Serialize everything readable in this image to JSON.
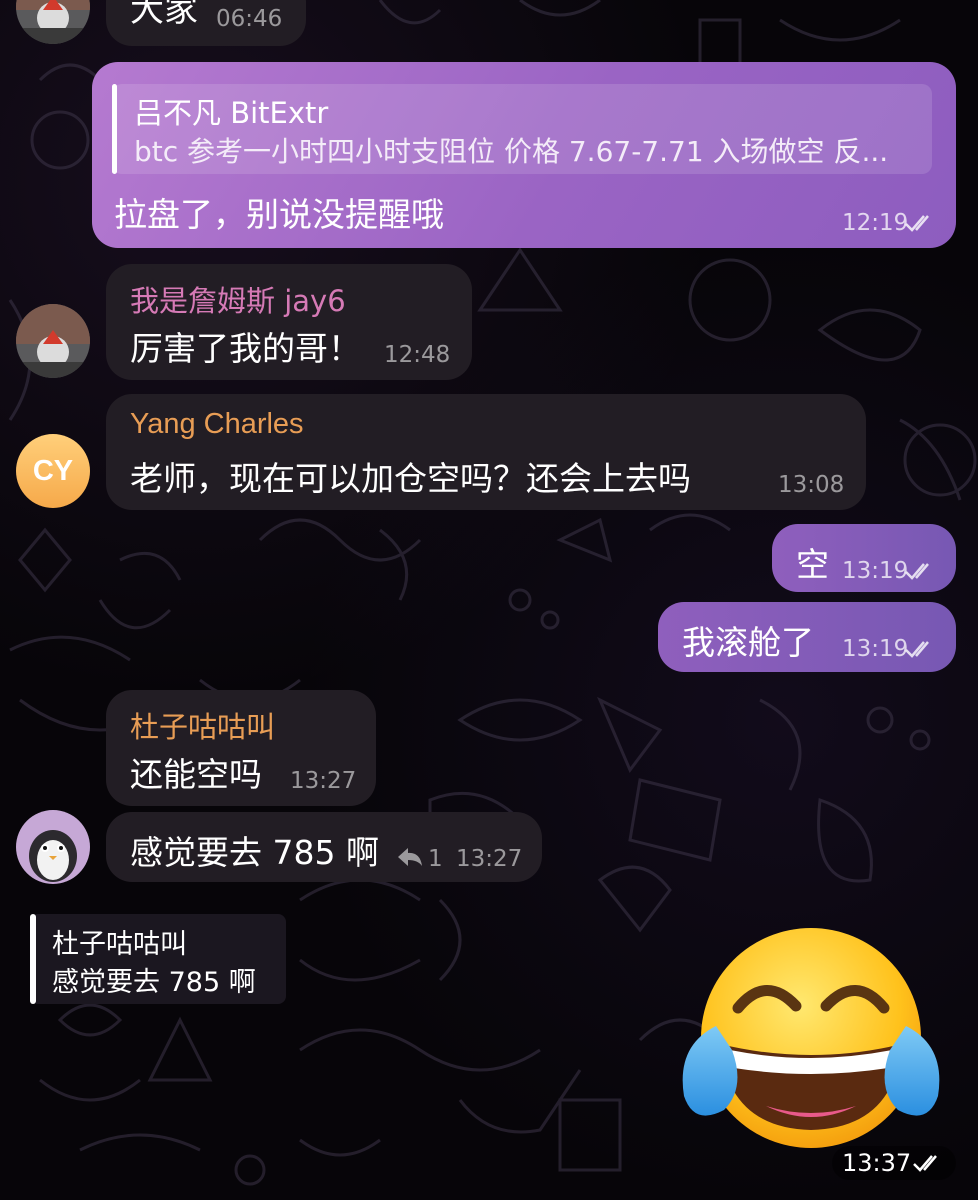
{
  "messages": [
    {
      "id": "m0",
      "text": "大家",
      "time": "06:46"
    },
    {
      "id": "m1",
      "quote_sender": "吕不凡 BitExtr",
      "quote_text": "btc 参考一小时四小时支阻位 价格 7.67-7.71 入场做空 反...",
      "text": "拉盘了，别说没提醒哦",
      "time": "12:19"
    },
    {
      "id": "m2",
      "sender": "我是詹姆斯 jay6",
      "text": "厉害了我的哥！",
      "time": "12:48"
    },
    {
      "id": "m3",
      "sender": "Yang Charles",
      "text": "老师，现在可以加仓空吗？还会上去吗",
      "time": "13:08"
    },
    {
      "id": "m4",
      "text": "空",
      "time": "13:19"
    },
    {
      "id": "m5",
      "text": "我滚舱了",
      "time": "13:19"
    },
    {
      "id": "m6",
      "sender": "杜子咕咕叫",
      "text": "还能空吗",
      "time": "13:27"
    },
    {
      "id": "m7",
      "text": "感觉要去 785 啊",
      "reply_count": "1",
      "time": "13:27"
    }
  ],
  "reply_preview": {
    "sender": "杜子咕咕叫",
    "text": "感觉要去 785 啊"
  },
  "sticker": {
    "name": "tears-of-joy-emoji",
    "time": "13:37"
  },
  "avatars": {
    "yang_charles_initials": "CY"
  },
  "colors": {
    "outgoing_bubble": "#8f5fbd",
    "incoming_bubble": "#221d24",
    "sender_pink": "#d67ab6",
    "sender_orange": "#e89d55",
    "quote_bar": "#ffffff"
  }
}
